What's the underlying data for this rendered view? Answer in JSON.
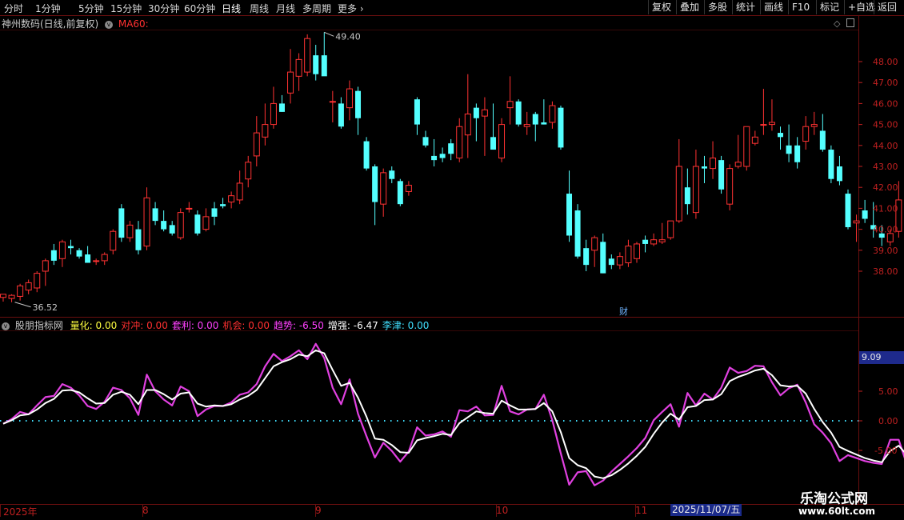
{
  "toolbar": {
    "periods": [
      "分时",
      "1分钟",
      "5分钟",
      "15分钟",
      "30分钟",
      "60分钟",
      "日线",
      "周线",
      "月线",
      "多周期",
      "更多"
    ],
    "active_period": "日线",
    "right_buttons": [
      "复权",
      "叠加",
      "多股",
      "统计",
      "画线",
      "F10",
      "标记",
      "+自选",
      "返回"
    ]
  },
  "main_panel": {
    "title": "神州数码(日线,前复权)",
    "indicator": "MA60:",
    "high_label": "49.40",
    "low_label": "36.52",
    "cai_label": "财"
  },
  "sub_panel": {
    "name": "股朋指标网",
    "items": [
      {
        "label": "量化:",
        "value": "0.00",
        "color": "#ffff40"
      },
      {
        "label": "对冲:",
        "value": "0.00",
        "color": "#ff3030"
      },
      {
        "label": "套利:",
        "value": "0.00",
        "color": "#ff40ff"
      },
      {
        "label": "机会:",
        "value": "0.00",
        "color": "#ff3030"
      },
      {
        "label": "趋势:",
        "value": "-6.50",
        "color": "#ff40ff"
      },
      {
        "label": "增强:",
        "value": "-6.47",
        "color": "#ffffff"
      },
      {
        "label": "李津:",
        "value": "0.00",
        "color": "#40e0ff"
      }
    ],
    "current_value": "9.09"
  },
  "bottom": {
    "months": [
      "2025年",
      "8",
      "9",
      "10",
      "11"
    ],
    "highlight_date": "2025/11/07/五"
  },
  "watermark": {
    "title": "乐淘公式网",
    "url": "www.60lt.com"
  },
  "colors": {
    "up": "#ff3232",
    "down": "#54ffff",
    "bg": "#000000",
    "grid": "#6a0f0f",
    "trend": "#e040e0",
    "enhance": "#ffffff",
    "zero": "#40e0ff"
  },
  "chart_data": [
    {
      "type": "candlestick",
      "y_ticks": [
        38.0,
        39.0,
        40.0,
        41.0,
        42.0,
        43.0,
        44.0,
        45.0,
        46.0,
        47.0,
        48.0
      ],
      "ylim": [
        36.0,
        50.0
      ],
      "candles": [
        {
          "o": 36.75,
          "h": 36.85,
          "l": 36.55,
          "c": 36.9
        },
        {
          "o": 36.7,
          "h": 36.9,
          "l": 36.52,
          "c": 36.85
        },
        {
          "o": 36.8,
          "h": 37.4,
          "l": 36.6,
          "c": 37.3
        },
        {
          "o": 37.1,
          "h": 37.6,
          "l": 36.9,
          "c": 37.45
        },
        {
          "o": 37.2,
          "h": 38.0,
          "l": 37.0,
          "c": 37.9
        },
        {
          "o": 38.0,
          "h": 38.6,
          "l": 37.3,
          "c": 38.5
        },
        {
          "o": 39.0,
          "h": 39.3,
          "l": 38.3,
          "c": 38.5
        },
        {
          "o": 38.6,
          "h": 39.5,
          "l": 38.2,
          "c": 39.4
        },
        {
          "o": 39.2,
          "h": 39.5,
          "l": 38.8,
          "c": 39.1
        },
        {
          "o": 39.0,
          "h": 39.1,
          "l": 38.6,
          "c": 38.7
        },
        {
          "o": 38.8,
          "h": 39.2,
          "l": 38.4,
          "c": 38.4
        },
        {
          "o": 38.5,
          "h": 38.6,
          "l": 38.3,
          "c": 38.5
        },
        {
          "o": 38.5,
          "h": 38.9,
          "l": 38.3,
          "c": 38.8
        },
        {
          "o": 39.0,
          "h": 40.0,
          "l": 38.8,
          "c": 39.9
        },
        {
          "o": 41.0,
          "h": 41.2,
          "l": 39.4,
          "c": 39.6
        },
        {
          "o": 39.6,
          "h": 40.4,
          "l": 39.4,
          "c": 40.2
        },
        {
          "o": 40.0,
          "h": 40.4,
          "l": 38.8,
          "c": 39.0
        },
        {
          "o": 39.2,
          "h": 42.0,
          "l": 39.0,
          "c": 41.5
        },
        {
          "o": 41.0,
          "h": 41.3,
          "l": 40.2,
          "c": 40.4
        },
        {
          "o": 40.4,
          "h": 40.9,
          "l": 39.9,
          "c": 40.0
        },
        {
          "o": 40.2,
          "h": 40.4,
          "l": 39.7,
          "c": 39.8
        },
        {
          "o": 39.6,
          "h": 41.0,
          "l": 39.5,
          "c": 40.8
        },
        {
          "o": 41.0,
          "h": 41.3,
          "l": 40.8,
          "c": 41.0
        },
        {
          "o": 40.7,
          "h": 40.9,
          "l": 39.7,
          "c": 39.8
        },
        {
          "o": 40.0,
          "h": 41.0,
          "l": 39.9,
          "c": 40.6
        },
        {
          "o": 41.0,
          "h": 41.3,
          "l": 40.2,
          "c": 40.6
        },
        {
          "o": 41.2,
          "h": 41.5,
          "l": 41.0,
          "c": 41.1
        },
        {
          "o": 41.3,
          "h": 41.8,
          "l": 41.0,
          "c": 41.6
        },
        {
          "o": 41.4,
          "h": 42.8,
          "l": 41.2,
          "c": 42.2
        },
        {
          "o": 42.4,
          "h": 43.5,
          "l": 42.0,
          "c": 43.2
        },
        {
          "o": 43.5,
          "h": 45.4,
          "l": 43.0,
          "c": 44.6
        },
        {
          "o": 44.4,
          "h": 46.0,
          "l": 44.0,
          "c": 45.0
        },
        {
          "o": 45.0,
          "h": 46.8,
          "l": 44.8,
          "c": 46.0
        },
        {
          "o": 46.0,
          "h": 46.4,
          "l": 45.6,
          "c": 45.6
        },
        {
          "o": 46.5,
          "h": 48.6,
          "l": 46.0,
          "c": 47.5
        },
        {
          "o": 47.3,
          "h": 48.4,
          "l": 46.6,
          "c": 48.1
        },
        {
          "o": 47.5,
          "h": 49.3,
          "l": 47.3,
          "c": 49.1
        },
        {
          "o": 48.3,
          "h": 48.8,
          "l": 47.1,
          "c": 47.4
        },
        {
          "o": 48.3,
          "h": 49.4,
          "l": 47.8,
          "c": 47.3
        },
        {
          "o": 46.1,
          "h": 46.6,
          "l": 45.1,
          "c": 46.1
        },
        {
          "o": 46.0,
          "h": 46.3,
          "l": 44.8,
          "c": 44.9
        },
        {
          "o": 45.8,
          "h": 47.1,
          "l": 45.2,
          "c": 46.7
        },
        {
          "o": 46.6,
          "h": 46.8,
          "l": 44.5,
          "c": 45.3
        },
        {
          "o": 44.2,
          "h": 44.4,
          "l": 42.8,
          "c": 42.9
        },
        {
          "o": 43.0,
          "h": 43.1,
          "l": 40.2,
          "c": 41.3
        },
        {
          "o": 41.2,
          "h": 42.9,
          "l": 40.6,
          "c": 42.7
        },
        {
          "o": 42.8,
          "h": 43.0,
          "l": 42.2,
          "c": 42.4
        },
        {
          "o": 42.3,
          "h": 42.4,
          "l": 41.1,
          "c": 41.2
        },
        {
          "o": 41.8,
          "h": 42.3,
          "l": 41.6,
          "c": 42.1
        },
        {
          "o": 46.2,
          "h": 46.3,
          "l": 44.5,
          "c": 45.0
        },
        {
          "o": 44.4,
          "h": 44.7,
          "l": 43.9,
          "c": 44.0
        },
        {
          "o": 43.5,
          "h": 44.3,
          "l": 43.0,
          "c": 43.3
        },
        {
          "o": 43.6,
          "h": 43.9,
          "l": 43.2,
          "c": 43.4
        },
        {
          "o": 44.1,
          "h": 44.3,
          "l": 43.3,
          "c": 43.6
        },
        {
          "o": 43.4,
          "h": 45.3,
          "l": 43.2,
          "c": 44.9
        },
        {
          "o": 44.5,
          "h": 47.4,
          "l": 43.4,
          "c": 45.5
        },
        {
          "o": 45.8,
          "h": 46.0,
          "l": 44.2,
          "c": 45.3
        },
        {
          "o": 45.4,
          "h": 46.3,
          "l": 43.5,
          "c": 45.7
        },
        {
          "o": 44.4,
          "h": 46.0,
          "l": 43.8,
          "c": 43.8
        },
        {
          "o": 43.4,
          "h": 45.3,
          "l": 43.2,
          "c": 45.0
        },
        {
          "o": 45.8,
          "h": 47.3,
          "l": 45.0,
          "c": 46.1
        },
        {
          "o": 46.1,
          "h": 46.2,
          "l": 44.9,
          "c": 45.0
        },
        {
          "o": 44.9,
          "h": 45.6,
          "l": 44.5,
          "c": 45.0
        },
        {
          "o": 45.5,
          "h": 45.6,
          "l": 44.2,
          "c": 45.0
        },
        {
          "o": 45.1,
          "h": 46.2,
          "l": 45.0,
          "c": 45.0
        },
        {
          "o": 45.1,
          "h": 46.1,
          "l": 44.8,
          "c": 45.9
        },
        {
          "o": 45.8,
          "h": 45.9,
          "l": 43.8,
          "c": 43.9
        },
        {
          "o": 41.7,
          "h": 42.8,
          "l": 39.4,
          "c": 39.7
        },
        {
          "o": 40.9,
          "h": 41.2,
          "l": 38.6,
          "c": 38.7
        },
        {
          "o": 39.1,
          "h": 39.5,
          "l": 38.0,
          "c": 38.3
        },
        {
          "o": 39.0,
          "h": 39.7,
          "l": 38.2,
          "c": 39.6
        },
        {
          "o": 39.4,
          "h": 39.8,
          "l": 37.9,
          "c": 37.9
        },
        {
          "o": 38.6,
          "h": 38.8,
          "l": 38.1,
          "c": 38.3
        },
        {
          "o": 38.3,
          "h": 38.9,
          "l": 38.1,
          "c": 38.7
        },
        {
          "o": 38.4,
          "h": 39.5,
          "l": 38.2,
          "c": 39.2
        },
        {
          "o": 38.6,
          "h": 39.4,
          "l": 38.4,
          "c": 39.3
        },
        {
          "o": 39.5,
          "h": 39.7,
          "l": 38.9,
          "c": 39.3
        },
        {
          "o": 39.3,
          "h": 39.8,
          "l": 39.2,
          "c": 39.5
        },
        {
          "o": 39.4,
          "h": 40.3,
          "l": 39.3,
          "c": 39.5
        },
        {
          "o": 39.6,
          "h": 40.4,
          "l": 39.5,
          "c": 40.4
        },
        {
          "o": 40.4,
          "h": 44.3,
          "l": 40.3,
          "c": 43.0
        },
        {
          "o": 42.0,
          "h": 42.9,
          "l": 40.7,
          "c": 41.2
        },
        {
          "o": 40.8,
          "h": 43.8,
          "l": 40.5,
          "c": 43.0
        },
        {
          "o": 43.0,
          "h": 43.5,
          "l": 42.2,
          "c": 42.9
        },
        {
          "o": 42.9,
          "h": 44.2,
          "l": 42.4,
          "c": 43.4
        },
        {
          "o": 43.3,
          "h": 43.5,
          "l": 41.7,
          "c": 41.9
        },
        {
          "o": 41.2,
          "h": 43.1,
          "l": 40.9,
          "c": 42.9
        },
        {
          "o": 43.0,
          "h": 44.5,
          "l": 42.9,
          "c": 43.2
        },
        {
          "o": 43.0,
          "h": 44.9,
          "l": 42.8,
          "c": 44.9
        },
        {
          "o": 44.1,
          "h": 44.7,
          "l": 44.0,
          "c": 44.4
        },
        {
          "o": 45.0,
          "h": 46.7,
          "l": 44.5,
          "c": 45.0
        },
        {
          "o": 45.0,
          "h": 46.2,
          "l": 44.7,
          "c": 45.1
        },
        {
          "o": 44.6,
          "h": 44.9,
          "l": 43.8,
          "c": 44.4
        },
        {
          "o": 44.0,
          "h": 45.0,
          "l": 43.2,
          "c": 43.6
        },
        {
          "o": 44.0,
          "h": 44.4,
          "l": 42.9,
          "c": 43.2
        },
        {
          "o": 44.2,
          "h": 45.4,
          "l": 43.8,
          "c": 44.9
        },
        {
          "o": 44.9,
          "h": 45.6,
          "l": 44.5,
          "c": 45.0
        },
        {
          "o": 44.7,
          "h": 45.5,
          "l": 43.7,
          "c": 43.8
        },
        {
          "o": 43.8,
          "h": 44.0,
          "l": 42.2,
          "c": 42.4
        },
        {
          "o": 43.0,
          "h": 43.5,
          "l": 42.1,
          "c": 42.3
        },
        {
          "o": 41.7,
          "h": 41.9,
          "l": 40.0,
          "c": 40.1
        },
        {
          "o": 40.3,
          "h": 40.7,
          "l": 39.4,
          "c": 40.4
        },
        {
          "o": 40.9,
          "h": 41.4,
          "l": 40.3,
          "c": 40.5
        },
        {
          "o": 40.2,
          "h": 41.3,
          "l": 39.6,
          "c": 40.0
        },
        {
          "o": 39.8,
          "h": 40.2,
          "l": 39.2,
          "c": 39.6
        },
        {
          "o": 39.4,
          "h": 40.0,
          "l": 39.2,
          "c": 39.8
        },
        {
          "o": 39.9,
          "h": 42.3,
          "l": 39.6,
          "c": 41.4
        },
        {
          "o": 41.7,
          "h": 41.9,
          "l": 40.7,
          "c": 41.4
        },
        {
          "o": 41.2,
          "h": 41.3,
          "l": 39.0,
          "c": 39.0
        },
        {
          "o": 39.0,
          "h": 39.2,
          "l": 38.4,
          "c": 39.2
        },
        {
          "o": 39.2,
          "h": 39.3,
          "l": 38.3,
          "c": 39.1
        }
      ]
    },
    {
      "type": "line",
      "y_ticks": [
        -5.0,
        0.0,
        5.0
      ],
      "ylim": [
        -12.5,
        12.5
      ],
      "zero_line": 0.0,
      "series": [
        {
          "name": "趋势",
          "values": [
            -0.5,
            0.3,
            1.5,
            1.1,
            2.6,
            4.0,
            4.2,
            6.2,
            5.6,
            4.3,
            2.5,
            2.0,
            3.2,
            5.6,
            5.2,
            3.8,
            1.0,
            7.8,
            5.0,
            3.6,
            2.6,
            5.8,
            5.0,
            0.8,
            1.9,
            2.5,
            2.5,
            3.1,
            4.4,
            4.8,
            6.2,
            9.2,
            11.3,
            10.1,
            10.9,
            11.9,
            10.4,
            13.0,
            10.6,
            5.6,
            2.8,
            7.0,
            1.2,
            -2.6,
            -6.2,
            -3.7,
            -5.1,
            -6.9,
            -5.2,
            -1.1,
            -2.5,
            -2.3,
            -1.8,
            -2.7,
            1.8,
            1.6,
            2.4,
            0.9,
            1.0,
            5.9,
            1.6,
            1.1,
            1.9,
            2.0,
            4.4,
            0.1,
            -5.5,
            -10.8,
            -8.7,
            -8.5,
            -10.9,
            -10.1,
            -8.6,
            -7.3,
            -6.0,
            -4.6,
            -2.9,
            0.1,
            1.5,
            2.8,
            -1.0,
            4.7,
            2.6,
            4.6,
            3.6,
            5.6,
            9.0,
            8.1,
            8.4,
            9.3,
            9.2,
            6.5,
            4.3,
            5.5,
            6.1,
            3.1,
            -0.6,
            -2.0,
            -3.8,
            -6.8,
            -5.8,
            -6.3,
            -6.8,
            -7.1,
            -7.3,
            -3.2,
            -3.2,
            -7.5,
            -6.9,
            -6.5
          ]
        },
        {
          "name": "增强",
          "values": [
            -0.5,
            0.1,
            0.9,
            1.1,
            1.9,
            3.0,
            3.7,
            5.1,
            5.2,
            4.8,
            3.8,
            2.9,
            3.0,
            4.4,
            4.9,
            4.4,
            2.8,
            5.2,
            5.2,
            4.5,
            3.6,
            4.6,
            4.8,
            2.9,
            2.4,
            2.6,
            2.5,
            2.8,
            3.6,
            4.2,
            5.2,
            7.2,
            9.2,
            9.9,
            10.4,
            11.2,
            10.9,
            11.9,
            11.4,
            8.6,
            5.9,
            6.4,
            3.9,
            0.7,
            -3.0,
            -3.2,
            -4.1,
            -5.3,
            -5.4,
            -3.3,
            -2.9,
            -2.6,
            -2.2,
            -2.4,
            -0.4,
            0.6,
            1.6,
            1.3,
            1.2,
            3.4,
            2.6,
            1.9,
            1.9,
            2.0,
            3.0,
            1.6,
            -1.9,
            -6.3,
            -7.5,
            -8.0,
            -9.4,
            -9.7,
            -9.2,
            -8.3,
            -7.2,
            -5.9,
            -4.4,
            -2.2,
            -0.3,
            1.2,
            0.2,
            2.3,
            2.5,
            3.5,
            3.6,
            4.5,
            6.7,
            7.4,
            7.9,
            8.5,
            8.8,
            7.7,
            6.0,
            5.8,
            5.9,
            4.6,
            2.0,
            -0.2,
            -2.0,
            -4.4,
            -5.1,
            -5.7,
            -6.3,
            -6.7,
            -7.0,
            -5.1,
            -4.2,
            -5.8,
            -6.4,
            -6.5
          ]
        }
      ]
    }
  ]
}
